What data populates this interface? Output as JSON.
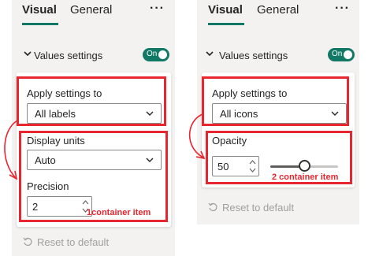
{
  "colors": {
    "accent": "#117865",
    "annotation": "#e8262f",
    "pane": "#f3f2f1"
  },
  "left_panel": {
    "tabs": [
      {
        "label": "Visual",
        "active": true
      },
      {
        "label": "General",
        "active": false
      }
    ],
    "more_icon": "···",
    "section": {
      "title": "Values settings",
      "toggle_label": "On",
      "toggle_on": true
    },
    "apply_settings": {
      "label": "Apply settings to",
      "value": "All labels"
    },
    "display_units": {
      "label": "Display units",
      "value": "Auto"
    },
    "precision": {
      "label": "Precision",
      "value": "2"
    },
    "annotation_label": "1container item",
    "reset_label": "Reset to default"
  },
  "right_panel": {
    "tabs": [
      {
        "label": "Visual",
        "active": true
      },
      {
        "label": "General",
        "active": false
      }
    ],
    "more_icon": "···",
    "section": {
      "title": "Values settings",
      "toggle_label": "On",
      "toggle_on": true
    },
    "apply_settings": {
      "label": "Apply settings to",
      "value": "All icons"
    },
    "opacity": {
      "label": "Opacity",
      "value": "50",
      "slider_level_percent": 50
    },
    "annotation_label": "2 container item",
    "reset_label": "Reset to default"
  }
}
